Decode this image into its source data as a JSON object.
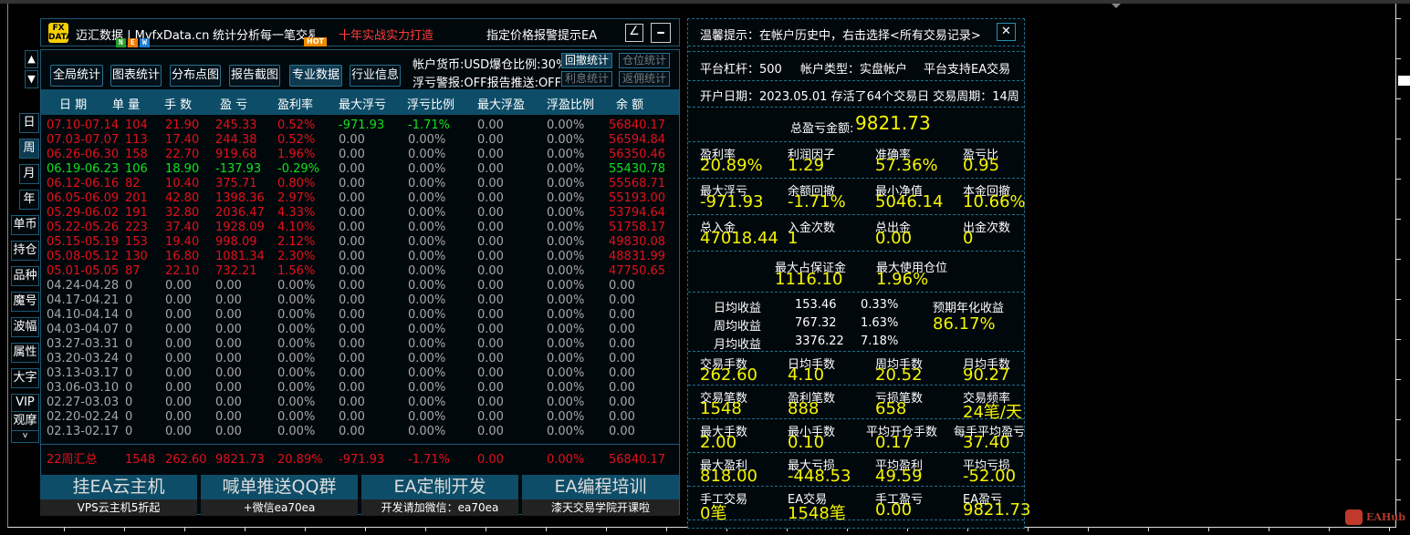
{
  "title_bar": {
    "logo_text": "FX DATA",
    "brand": "迈汇数据 | MyfxData.cn",
    "slogan": "统计分析每一笔交易",
    "highlight": "十年实战实力打造",
    "promo": "指定价格报警提示EA",
    "draw_button": "∠",
    "minimize_button": "━"
  },
  "scroll": {
    "up": "▲",
    "down": "▼"
  },
  "nav_buttons": [
    {
      "label": "全局统计"
    },
    {
      "label": "图表统计",
      "badge": "NEW"
    },
    {
      "label": "分布点图"
    },
    {
      "label": "报告截图"
    },
    {
      "label": "专业数据",
      "badge": "HOT"
    },
    {
      "label": "行业信息"
    }
  ],
  "account_info": {
    "line1": "帐户货币:USD爆仓比例:30%",
    "line2": "浮亏警报:OFF报告推送:OFF"
  },
  "small_buttons": [
    "回撤统计",
    "仓位统计",
    "利息统计",
    "返佣统计"
  ],
  "table": {
    "headers": [
      "日 期",
      "单 量",
      "手 数",
      "盈 亏",
      "盈利率",
      "最大浮亏",
      "浮亏比例",
      "最大浮盈",
      "浮盈比例",
      "余 额"
    ],
    "rows": [
      {
        "status": "profit",
        "cells": [
          "07.10-07.14",
          "104",
          "21.90",
          "245.33",
          "0.52%",
          "-971.93",
          "-1.71%",
          "0.00",
          "0.00%",
          "56840.17"
        ]
      },
      {
        "status": "profit",
        "cells": [
          "07.03-07.07",
          "113",
          "17.40",
          "244.38",
          "0.52%",
          "0.00",
          "0.00%",
          "0.00",
          "0.00%",
          "56594.84"
        ]
      },
      {
        "status": "profit",
        "cells": [
          "06.26-06.30",
          "158",
          "22.70",
          "919.68",
          "1.96%",
          "0.00",
          "0.00%",
          "0.00",
          "0.00%",
          "56350.46"
        ]
      },
      {
        "status": "loss",
        "cells": [
          "06.19-06.23",
          "106",
          "18.90",
          "-137.93",
          "-0.29%",
          "0.00",
          "0.00%",
          "0.00",
          "0.00%",
          "55430.78"
        ]
      },
      {
        "status": "profit",
        "cells": [
          "06.12-06.16",
          "82",
          "10.40",
          "375.71",
          "0.80%",
          "0.00",
          "0.00%",
          "0.00",
          "0.00%",
          "55568.71"
        ]
      },
      {
        "status": "profit",
        "cells": [
          "06.05-06.09",
          "201",
          "42.80",
          "1398.36",
          "2.97%",
          "0.00",
          "0.00%",
          "0.00",
          "0.00%",
          "55193.00"
        ]
      },
      {
        "status": "profit",
        "cells": [
          "05.29-06.02",
          "191",
          "32.80",
          "2036.47",
          "4.33%",
          "0.00",
          "0.00%",
          "0.00",
          "0.00%",
          "53794.64"
        ]
      },
      {
        "status": "profit",
        "cells": [
          "05.22-05.26",
          "223",
          "37.40",
          "1928.09",
          "4.10%",
          "0.00",
          "0.00%",
          "0.00",
          "0.00%",
          "51758.17"
        ]
      },
      {
        "status": "profit",
        "cells": [
          "05.15-05.19",
          "153",
          "19.40",
          "998.09",
          "2.12%",
          "0.00",
          "0.00%",
          "0.00",
          "0.00%",
          "49830.08"
        ]
      },
      {
        "status": "profit",
        "cells": [
          "05.08-05.12",
          "130",
          "16.80",
          "1081.34",
          "2.30%",
          "0.00",
          "0.00%",
          "0.00",
          "0.00%",
          "48831.99"
        ]
      },
      {
        "status": "profit",
        "cells": [
          "05.01-05.05",
          "87",
          "22.10",
          "732.21",
          "1.56%",
          "0.00",
          "0.00%",
          "0.00",
          "0.00%",
          "47750.65"
        ]
      },
      {
        "status": "none",
        "cells": [
          "04.24-04.28",
          "0",
          "0.00",
          "0.00",
          "0.00%",
          "0.00",
          "0.00%",
          "0.00",
          "0.00%",
          "0.00"
        ]
      },
      {
        "status": "none",
        "cells": [
          "04.17-04.21",
          "0",
          "0.00",
          "0.00",
          "0.00%",
          "0.00",
          "0.00%",
          "0.00",
          "0.00%",
          "0.00"
        ]
      },
      {
        "status": "none",
        "cells": [
          "04.10-04.14",
          "0",
          "0.00",
          "0.00",
          "0.00%",
          "0.00",
          "0.00%",
          "0.00",
          "0.00%",
          "0.00"
        ]
      },
      {
        "status": "none",
        "cells": [
          "04.03-04.07",
          "0",
          "0.00",
          "0.00",
          "0.00%",
          "0.00",
          "0.00%",
          "0.00",
          "0.00%",
          "0.00"
        ]
      },
      {
        "status": "none",
        "cells": [
          "03.27-03.31",
          "0",
          "0.00",
          "0.00",
          "0.00%",
          "0.00",
          "0.00%",
          "0.00",
          "0.00%",
          "0.00"
        ]
      },
      {
        "status": "none",
        "cells": [
          "03.20-03.24",
          "0",
          "0.00",
          "0.00",
          "0.00%",
          "0.00",
          "0.00%",
          "0.00",
          "0.00%",
          "0.00"
        ]
      },
      {
        "status": "none",
        "cells": [
          "03.13-03.17",
          "0",
          "0.00",
          "0.00",
          "0.00%",
          "0.00",
          "0.00%",
          "0.00",
          "0.00%",
          "0.00"
        ]
      },
      {
        "status": "none",
        "cells": [
          "03.06-03.10",
          "0",
          "0.00",
          "0.00",
          "0.00%",
          "0.00",
          "0.00%",
          "0.00",
          "0.00%",
          "0.00"
        ]
      },
      {
        "status": "none",
        "cells": [
          "02.27-03.03",
          "0",
          "0.00",
          "0.00",
          "0.00%",
          "0.00",
          "0.00%",
          "0.00",
          "0.00%",
          "0.00"
        ]
      },
      {
        "status": "none",
        "cells": [
          "02.20-02.24",
          "0",
          "0.00",
          "0.00",
          "0.00%",
          "0.00",
          "0.00%",
          "0.00",
          "0.00%",
          "0.00"
        ]
      },
      {
        "status": "none",
        "cells": [
          "02.13-02.17",
          "0",
          "0.00",
          "0.00",
          "0.00%",
          "0.00",
          "0.00%",
          "0.00",
          "0.00%",
          "0.00"
        ]
      }
    ],
    "summary": [
      "22周汇总",
      "1548",
      "262.60",
      "9821.73",
      "20.89%",
      "-971.93",
      "-1.71%",
      "0.00",
      "0.00%",
      "56840.17"
    ]
  },
  "side_buttons": [
    "日",
    "周",
    "月",
    "年",
    "单币",
    "持仓",
    "品种",
    "魔号",
    "波幅",
    "属性",
    "大字",
    "VIP",
    "观摩",
    "v"
  ],
  "promos": [
    {
      "title": "挂EA云主机",
      "sub": "VPS云主机5折起"
    },
    {
      "title": "喊单推送QQ群",
      "sub": "+微信ea70ea"
    },
    {
      "title": "EA定制开发",
      "sub": "开发请加微信：ea70ea"
    },
    {
      "title": "EA编程培训",
      "sub": "漆天交易学院开课啦"
    }
  ],
  "right_panel": {
    "tip": "温馨提示：在帐户历史中，右击选择<所有交易记录>",
    "close": "✕",
    "leverage": "平台杠杆：500",
    "account_type": "帐户类型：实盘帐户",
    "ea_support": "平台支持EA交易",
    "open_date": "开户日期：2023.05.01 存活了64个交易日  交易周期：14周",
    "total_label": "总盈亏金额:",
    "total_value": "9821.73",
    "grid1": [
      {
        "label": "盈利率",
        "value": "20.89%"
      },
      {
        "label": "利润因子",
        "value": "1.29"
      },
      {
        "label": "准确率",
        "value": "57.36%"
      },
      {
        "label": "盈亏比",
        "value": "0.95"
      },
      {
        "label": "最大浮亏",
        "value": "-971.93"
      },
      {
        "label": "余额回撤",
        "value": "-1.71%"
      },
      {
        "label": "最小净值",
        "value": "5046.14"
      },
      {
        "label": "本金回撤",
        "value": "10.66%"
      },
      {
        "label": "总入金",
        "value": "47018.44"
      },
      {
        "label": "入金次数",
        "value": "1"
      },
      {
        "label": "总出金",
        "value": "0.00"
      },
      {
        "label": "出金次数",
        "value": "0"
      }
    ],
    "margin": [
      {
        "label": "最大占保证金",
        "value": "1116.10"
      },
      {
        "label": "最大使用仓位",
        "value": "1.96%"
      }
    ],
    "daily": [
      {
        "label": "日均收益",
        "amount": "153.46",
        "pct": "0.33%"
      },
      {
        "label": "周均收益",
        "amount": "767.32",
        "pct": "1.63%"
      },
      {
        "label": "月均收益",
        "amount": "3376.22",
        "pct": "7.18%"
      }
    ],
    "annual_label": "预期年化收益",
    "annual_value": "86.17%",
    "grid2": [
      {
        "label": "交易手数",
        "value": "262.60"
      },
      {
        "label": "日均手数",
        "value": "4.10"
      },
      {
        "label": "周均手数",
        "value": "20.52"
      },
      {
        "label": "月均手数",
        "value": "90.27"
      },
      {
        "label": "交易笔数",
        "value": "1548"
      },
      {
        "label": "盈利笔数",
        "value": "888"
      },
      {
        "label": "亏损笔数",
        "value": "658"
      },
      {
        "label": "交易频率",
        "value": "24笔/天"
      },
      {
        "label": "最大手数",
        "value": "2.00"
      },
      {
        "label": "最小手数",
        "value": "0.10"
      },
      {
        "label": "平均开仓手数",
        "value": "0.17"
      },
      {
        "label": "每手平均盈亏",
        "value": "37.40"
      },
      {
        "label": "最大盈利",
        "value": "818.00"
      },
      {
        "label": "最大亏损",
        "value": "-448.53"
      },
      {
        "label": "平均盈利",
        "value": "49.59"
      },
      {
        "label": "平均亏损",
        "value": "-52.00"
      },
      {
        "label": "手工交易",
        "value": "0笔"
      },
      {
        "label": "EA交易",
        "value": "1548笔"
      },
      {
        "label": "手工盈亏",
        "value": "0.00"
      },
      {
        "label": "EA盈亏",
        "value": "9821.73"
      }
    ]
  },
  "watermark": "EAHub"
}
